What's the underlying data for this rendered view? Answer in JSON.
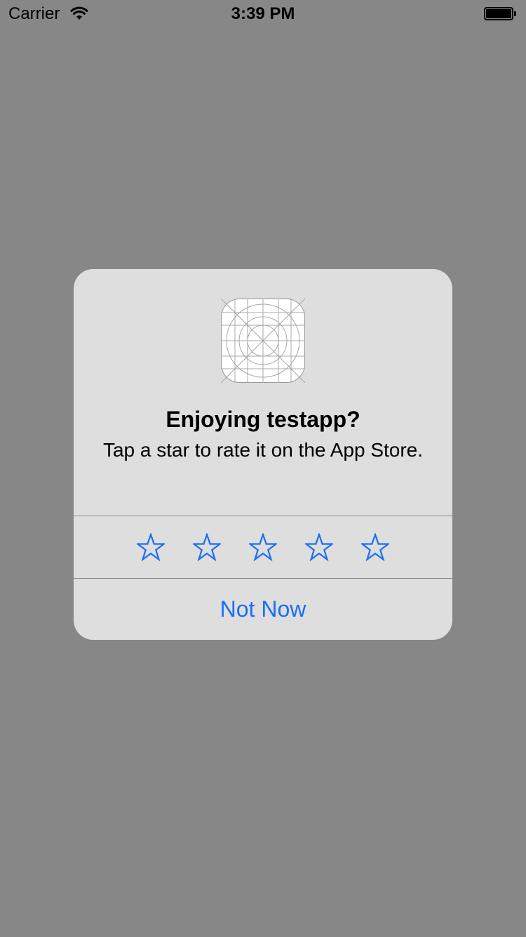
{
  "status_bar": {
    "carrier": "Carrier",
    "time": "3:39 PM",
    "wifi_icon": "wifi-icon",
    "battery_icon": "battery-icon"
  },
  "alert": {
    "app_icon": "app-icon-placeholder",
    "title": "Enjoying testapp?",
    "message": "Tap a star to rate it on the App Store.",
    "stars": [
      {
        "icon": "star-outline-icon",
        "rating": 1
      },
      {
        "icon": "star-outline-icon",
        "rating": 2
      },
      {
        "icon": "star-outline-icon",
        "rating": 3
      },
      {
        "icon": "star-outline-icon",
        "rating": 4
      },
      {
        "icon": "star-outline-icon",
        "rating": 5
      }
    ],
    "selected_rating": 0,
    "dismiss_label": "Not Now"
  },
  "colors": {
    "backdrop": "#878787",
    "alert_background": "#dedede",
    "accent": "#1a6ef5",
    "divider": "#8c8c8c"
  }
}
